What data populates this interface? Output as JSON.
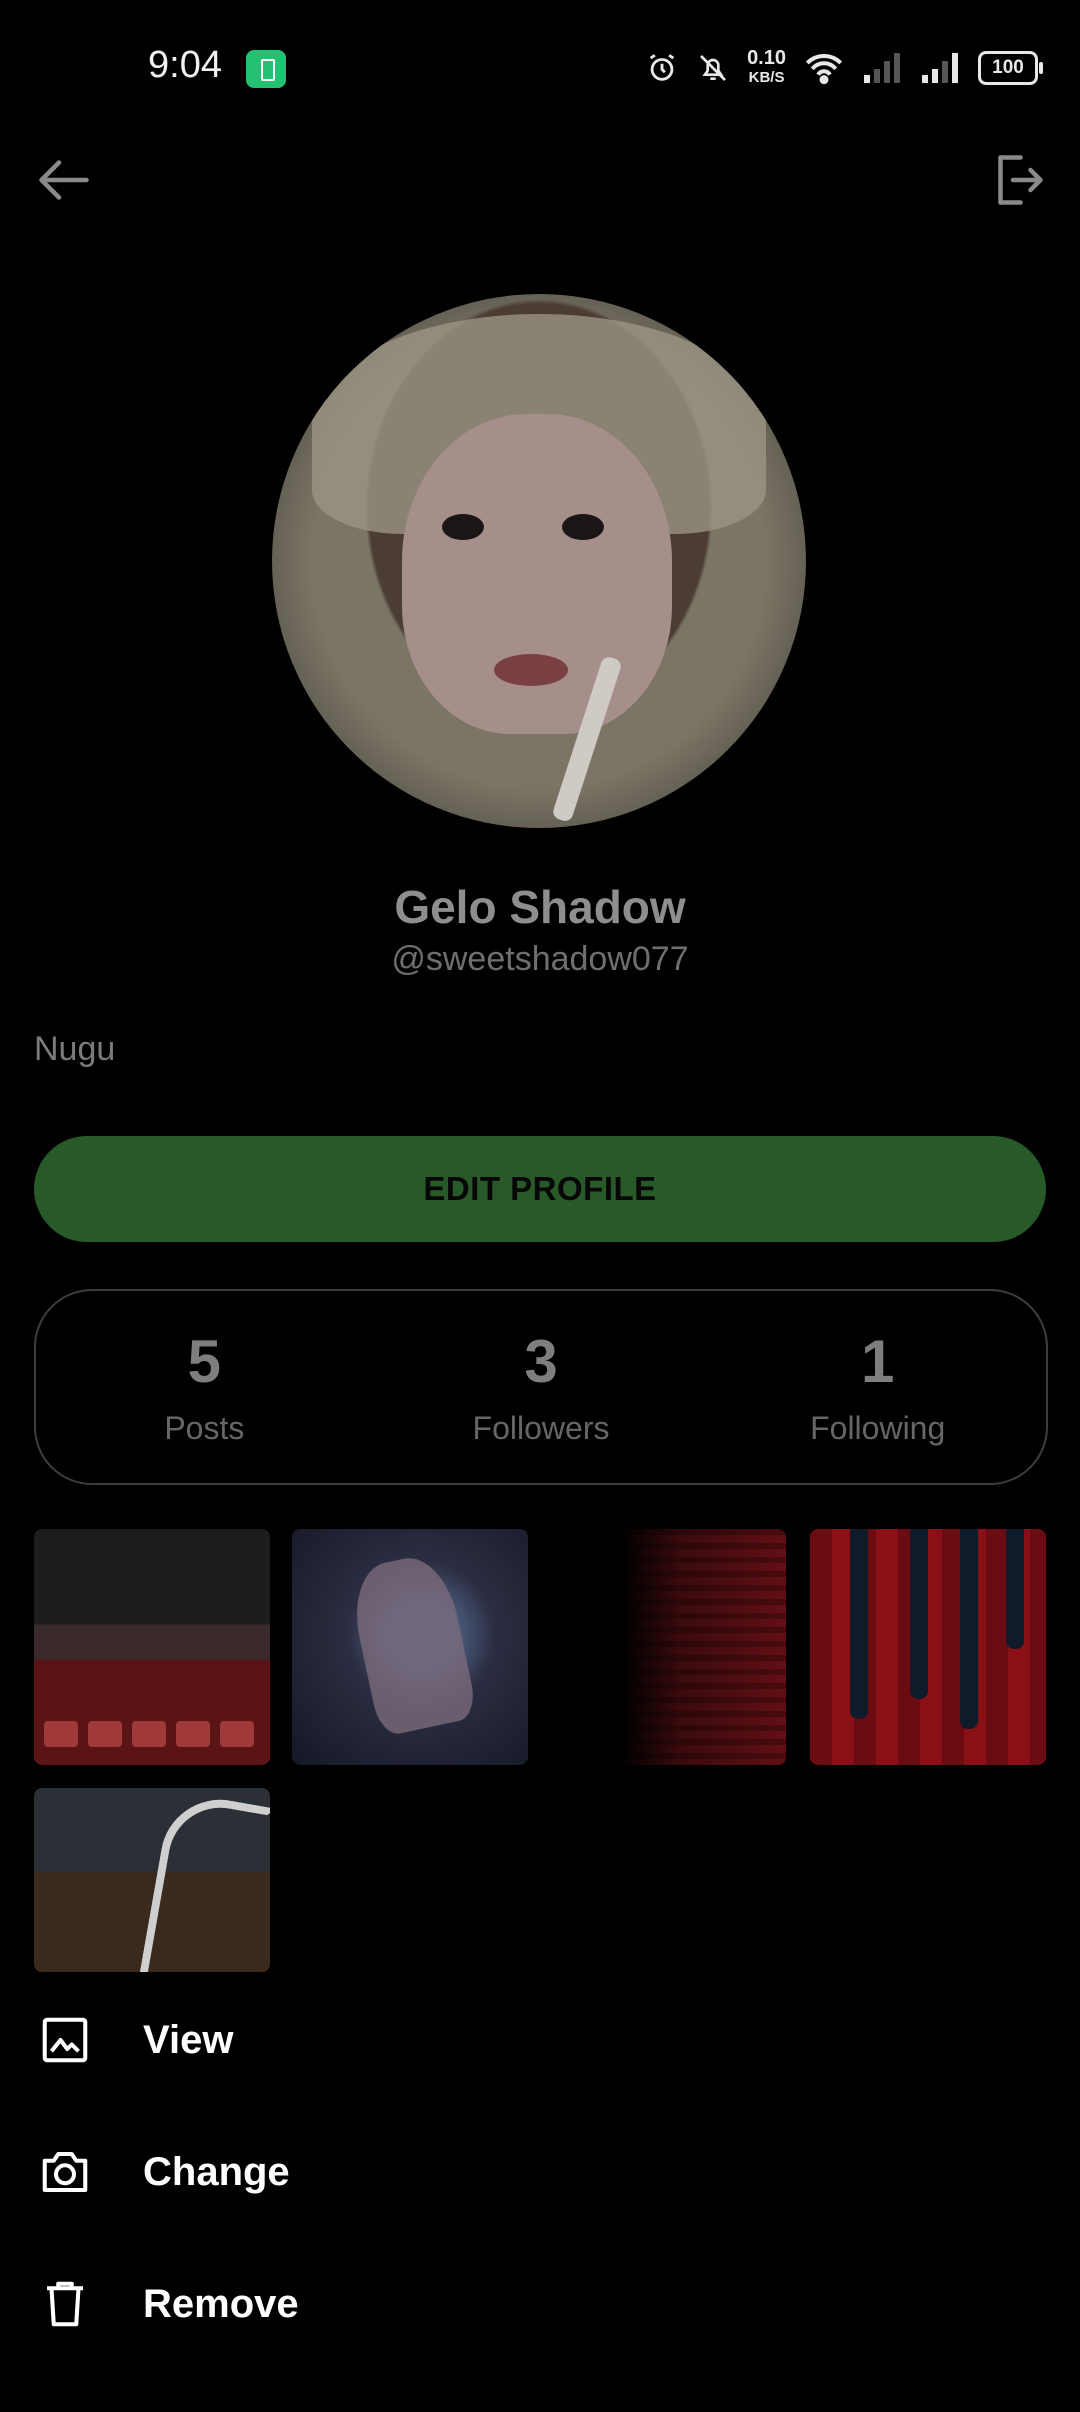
{
  "status_bar": {
    "time": "9:04",
    "net_speed_value": "0.10",
    "net_speed_unit": "KB/S",
    "battery_level": "100"
  },
  "profile": {
    "name": "Gelo Shadow",
    "handle": "@sweetshadow077",
    "bio": "Nugu",
    "edit_label": "EDIT PROFILE"
  },
  "stats": [
    {
      "value": "5",
      "label": "Posts"
    },
    {
      "value": "3",
      "label": "Followers"
    },
    {
      "value": "1",
      "label": "Following"
    }
  ],
  "menu": [
    {
      "label": "View",
      "icon": "image-icon"
    },
    {
      "label": "Change",
      "icon": "camera-icon"
    },
    {
      "label": "Remove",
      "icon": "trash-icon"
    }
  ],
  "colors": {
    "background": "#000000",
    "edit_button": "#275a28",
    "status_app_icon": "#25c173"
  }
}
